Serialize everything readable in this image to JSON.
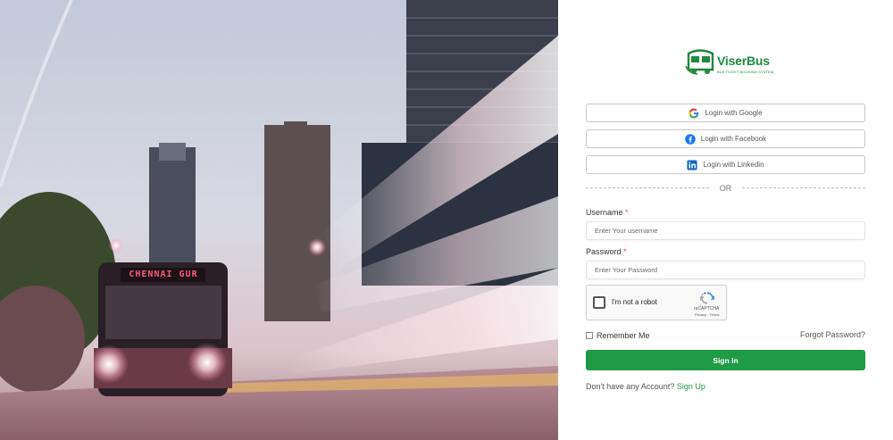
{
  "brand": {
    "name": "ViserBus",
    "tagline": "BUS TICKET BOOKING SYSTEM",
    "color": "#1f8a3c"
  },
  "hero": {
    "bus_sign": "CHENNAI GUR",
    "icon": "city-bus-photo"
  },
  "social": {
    "google": {
      "label": "Login with Google",
      "icon": "google-icon"
    },
    "facebook": {
      "label": "Login with Facebook",
      "icon": "facebook-icon"
    },
    "linkedin": {
      "label": "Login with Linkedin",
      "icon": "linkedin-icon"
    }
  },
  "divider": {
    "text": "OR"
  },
  "form": {
    "username_label": "Username",
    "username_placeholder": "Enter Your username",
    "username_value": "",
    "password_label": "Password",
    "password_placeholder": "Enter Your Password",
    "password_value": "",
    "required_mark": "*",
    "captcha": {
      "label": "I'm not a robot",
      "brand": "reCAPTCHA",
      "links": "Privacy - Terms"
    },
    "remember_label": "Remember Me",
    "forgot_label": "Forgot Password?",
    "submit_label": "Sign In",
    "signup_prompt": "Don't have any Account?",
    "signup_link": "Sign Up"
  },
  "colors": {
    "accent": "#1f9a45",
    "required": "#e24b4b"
  }
}
